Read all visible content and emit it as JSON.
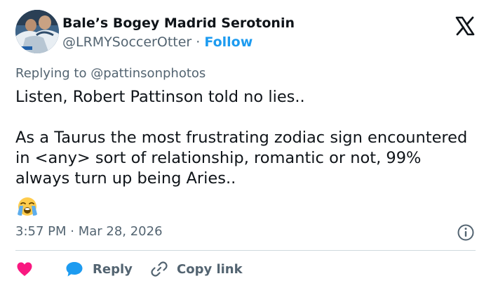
{
  "author": {
    "display_name": "Bale’s Bogey Madrid Serotonin",
    "handle": "@LRMYSoccerOtter",
    "separator": "·",
    "follow_label": "Follow",
    "avatar_icon": "profile-photo-icon"
  },
  "reply_context": "Replying to @pattinsonphotos",
  "tweet": {
    "text": "Listen, Robert Pattinson told no lies..\n\nAs a Taurus the most frustrating zodiac sign encountered in <any> sort of relationship, romantic or not, 99% always turn up being Aries..",
    "emoji_icon": "loudly-crying-face-emoji"
  },
  "meta": {
    "timestamp": "3:57 PM · Mar 28, 2026"
  },
  "actions": {
    "like_icon": "heart-icon",
    "reply_icon": "speech-bubble-icon",
    "reply_label": "Reply",
    "copy_icon": "link-icon",
    "copy_label": "Copy link"
  },
  "colors": {
    "accent": "#1d9bf0",
    "like": "#f91880",
    "secondary_text": "#536471",
    "primary_text": "#0f1419"
  }
}
